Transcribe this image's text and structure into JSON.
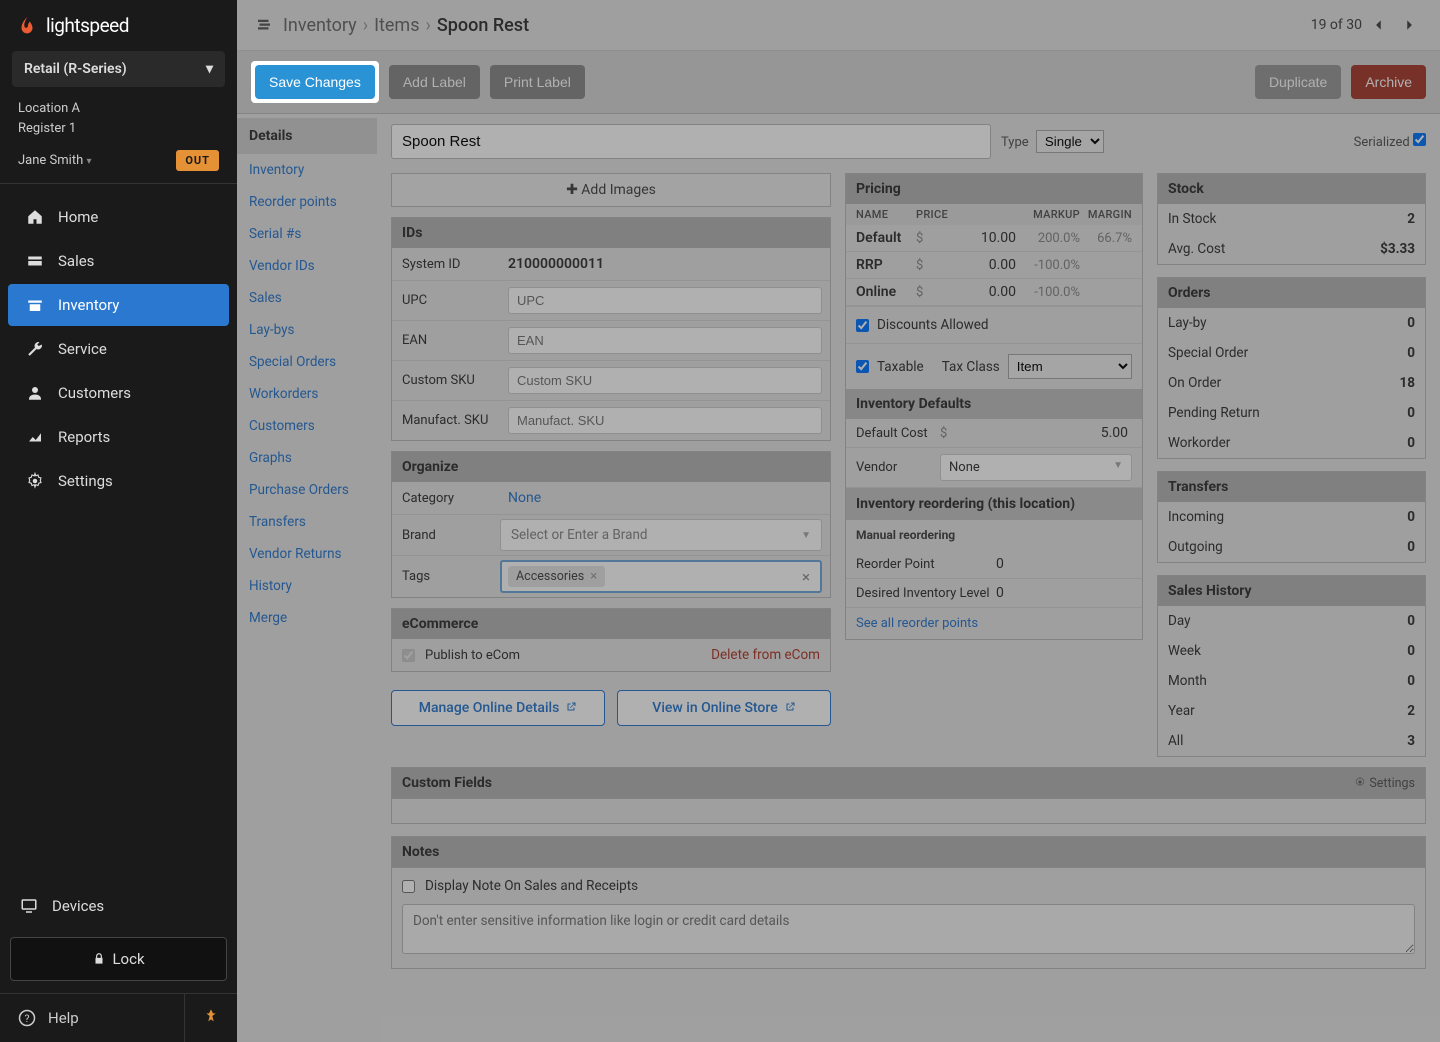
{
  "brand": "lightspeed",
  "series": "Retail (R-Series)",
  "location": {
    "name": "Location A",
    "register": "Register 1"
  },
  "user": "Jane Smith",
  "out_badge": "OUT",
  "nav": [
    {
      "label": "Home",
      "icon": "home"
    },
    {
      "label": "Sales",
      "icon": "cash"
    },
    {
      "label": "Inventory",
      "icon": "box"
    },
    {
      "label": "Service",
      "icon": "wrench"
    },
    {
      "label": "Customers",
      "icon": "user"
    },
    {
      "label": "Reports",
      "icon": "chart"
    },
    {
      "label": "Settings",
      "icon": "gear"
    }
  ],
  "devices": "Devices",
  "lock": "Lock",
  "help": "Help",
  "breadcrumbs": {
    "root": "Inventory",
    "mid": "Items",
    "cur": "Spoon Rest"
  },
  "pager": {
    "text": "19 of 30"
  },
  "actions": {
    "save": "Save Changes",
    "add_label": "Add Label",
    "print_label": "Print Label",
    "duplicate": "Duplicate",
    "archive": "Archive"
  },
  "subnav": {
    "title": "Details",
    "items": [
      "Inventory",
      "Reorder points",
      "Serial #s",
      "Vendor IDs",
      "Sales",
      "Lay-bys",
      "Special Orders",
      "Workorders",
      "Customers",
      "Graphs",
      "Purchase Orders",
      "Transfers",
      "Vendor Returns",
      "History",
      "Merge"
    ]
  },
  "item": {
    "name": "Spoon Rest",
    "type_label": "Type",
    "type_value": "Single",
    "serialized_label": "Serialized",
    "add_images": "Add Images",
    "ids": {
      "title": "IDs",
      "system_id_label": "System ID",
      "system_id": "210000000011",
      "upc_label": "UPC",
      "upc_placeholder": "UPC",
      "ean_label": "EAN",
      "ean_placeholder": "EAN",
      "csku_label": "Custom SKU",
      "csku_placeholder": "Custom SKU",
      "msku_label": "Manufact. SKU",
      "msku_placeholder": "Manufact. SKU"
    },
    "organize": {
      "title": "Organize",
      "category_label": "Category",
      "category_value": "None",
      "brand_label": "Brand",
      "brand_placeholder": "Select or Enter a Brand",
      "tags_label": "Tags",
      "tags": [
        "Accessories"
      ]
    },
    "ecom": {
      "title": "eCommerce",
      "publish_label": "Publish to eCom",
      "delete": "Delete from eCom",
      "manage": "Manage Online Details",
      "view": "View in Online Store"
    }
  },
  "pricing": {
    "title": "Pricing",
    "headers": {
      "name": "NAME",
      "price": "PRICE",
      "markup": "MARKUP",
      "margin": "MARGIN"
    },
    "rows": [
      {
        "name": "Default",
        "price": "10.00",
        "markup": "200.0%",
        "margin": "66.7%"
      },
      {
        "name": "RRP",
        "price": "0.00",
        "markup": "-100.0%",
        "margin": ""
      },
      {
        "name": "Online",
        "price": "0.00",
        "markup": "-100.0%",
        "margin": ""
      }
    ],
    "discounts_label": "Discounts Allowed",
    "taxable_label": "Taxable",
    "tax_class_label": "Tax Class",
    "tax_class_value": "Item",
    "defaults_title": "Inventory Defaults",
    "default_cost_label": "Default Cost",
    "default_cost": "5.00",
    "vendor_label": "Vendor",
    "vendor_value": "None",
    "reorder_title": "Inventory reordering (this location)",
    "manual_title": "Manual reordering",
    "reorder_point_label": "Reorder Point",
    "reorder_point": "0",
    "desired_label": "Desired Inventory Level",
    "desired": "0",
    "see_all": "See all reorder points"
  },
  "stock": {
    "title": "Stock",
    "in_stock_label": "In Stock",
    "in_stock": "2",
    "avg_cost_label": "Avg. Cost",
    "avg_cost": "$3.33"
  },
  "orders": {
    "title": "Orders",
    "rows": [
      {
        "k": "Lay-by",
        "v": "0"
      },
      {
        "k": "Special Order",
        "v": "0"
      },
      {
        "k": "On Order",
        "v": "18"
      },
      {
        "k": "Pending Return",
        "v": "0"
      },
      {
        "k": "Workorder",
        "v": "0"
      }
    ]
  },
  "transfers": {
    "title": "Transfers",
    "rows": [
      {
        "k": "Incoming",
        "v": "0"
      },
      {
        "k": "Outgoing",
        "v": "0"
      }
    ]
  },
  "sales_history": {
    "title": "Sales History",
    "rows": [
      {
        "k": "Day",
        "v": "0"
      },
      {
        "k": "Week",
        "v": "0"
      },
      {
        "k": "Month",
        "v": "0"
      },
      {
        "k": "Year",
        "v": "2"
      },
      {
        "k": "All",
        "v": "3"
      }
    ]
  },
  "custom_fields": {
    "title": "Custom Fields",
    "settings": "Settings"
  },
  "notes": {
    "title": "Notes",
    "display_label": "Display Note On Sales and Receipts",
    "placeholder": "Don't enter sensitive information like login or credit card details"
  }
}
